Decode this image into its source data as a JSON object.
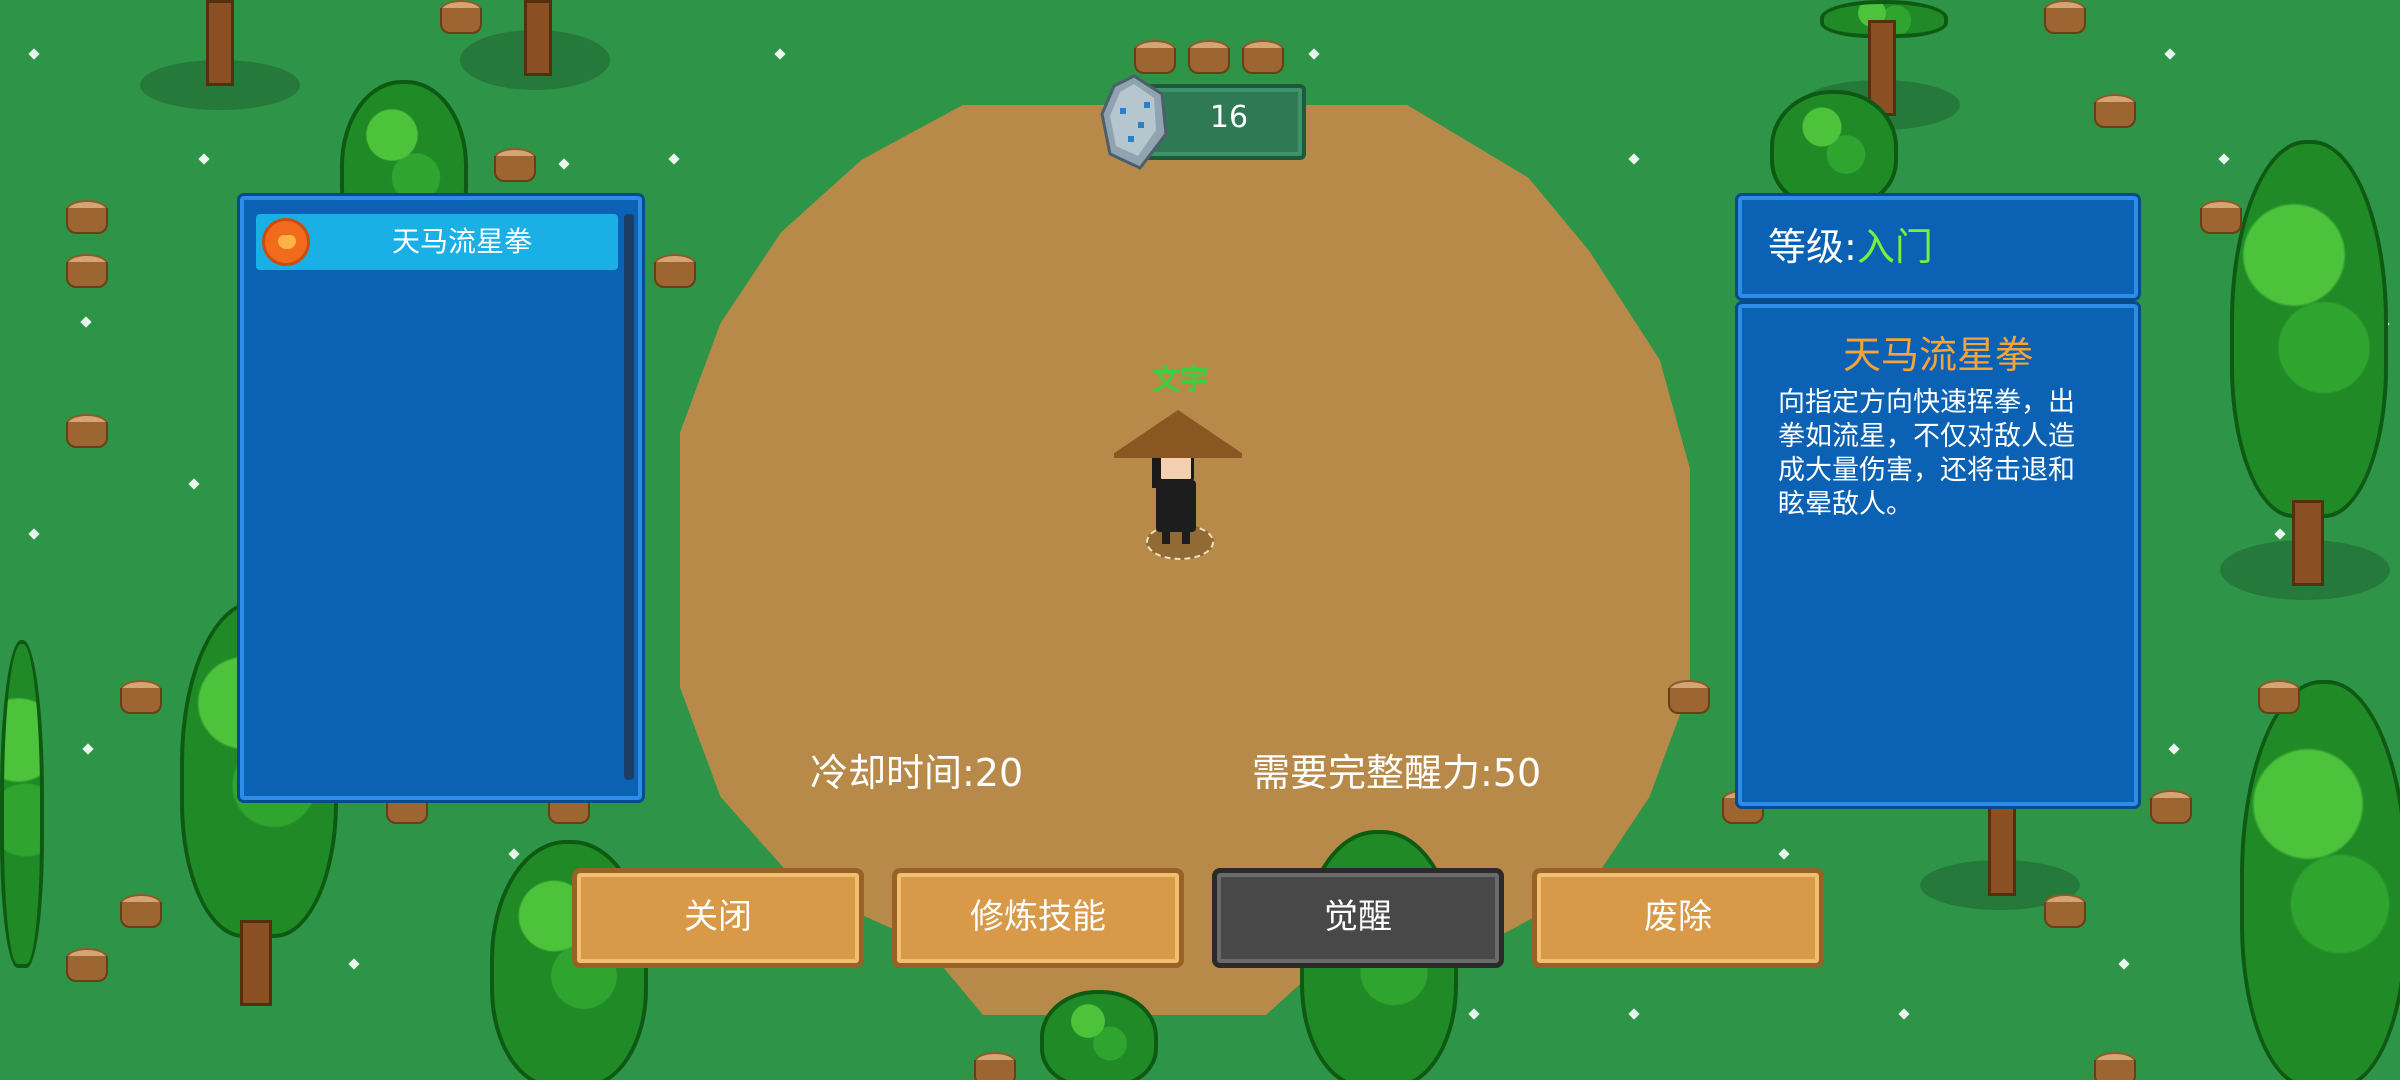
{
  "hud": {
    "gem_count": "16"
  },
  "skill_list": {
    "items": [
      {
        "name": "天马流星拳",
        "icon": "fist-icon",
        "selected": true
      }
    ]
  },
  "player": {
    "name": "文宇"
  },
  "skill_detail": {
    "level_label": "等级:",
    "level_value": "入门",
    "title": "天马流星拳",
    "description": "向指定方向快速挥拳，出拳如流星，不仅对敌人造成大量伤害，还将击退和眩晕敌人。"
  },
  "stats": {
    "cooldown": "冷却时间:20",
    "requirement": "需要完整醒力:50"
  },
  "buttons": {
    "close": "关闭",
    "train": "修炼技能",
    "awaken": "觉醒",
    "remove": "废除"
  },
  "colors": {
    "grass": "#2e9447",
    "dirt": "#b88a4a",
    "panel": "#0b61b3",
    "panel_border": "#2c8ce8",
    "selected_item": "#1ab0e6",
    "level_value": "#79f23a",
    "skill_title": "#f6a43a",
    "player_name": "#3ccf3c",
    "button_orange": "#d89a49",
    "button_gray": "#484848"
  }
}
